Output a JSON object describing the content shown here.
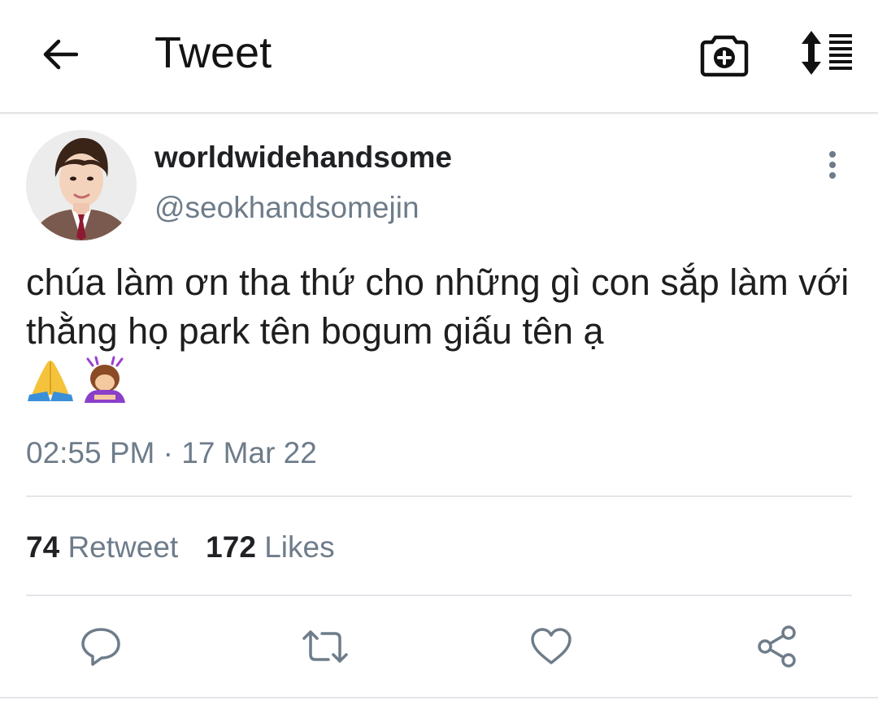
{
  "header": {
    "title": "Tweet",
    "back_icon": "arrow-left-icon",
    "camera_icon": "camera-plus-icon",
    "sort_icon": "sort-list-icon"
  },
  "tweet": {
    "display_name": "worldwidehandsome",
    "handle": "@seokhandsomejin",
    "text": "chúa làm ơn tha thứ cho những gì con sắp làm với thằng họ park tên bogum giấu tên ạ",
    "emojis": [
      "folded-hands-emoji",
      "person-bowing-emoji"
    ],
    "timestamp": "02:55 PM · 17 Mar 22",
    "retweet_count": "74",
    "retweet_label": "Retweet",
    "likes_count": "172",
    "likes_label": "Likes"
  },
  "actions": [
    "reply-icon",
    "retweet-icon",
    "like-icon",
    "share-icon"
  ],
  "colors": {
    "text_primary": "#202124",
    "text_secondary": "#6e7c8a",
    "icon": "#6e7c8a",
    "divider": "#e3e6ea"
  }
}
